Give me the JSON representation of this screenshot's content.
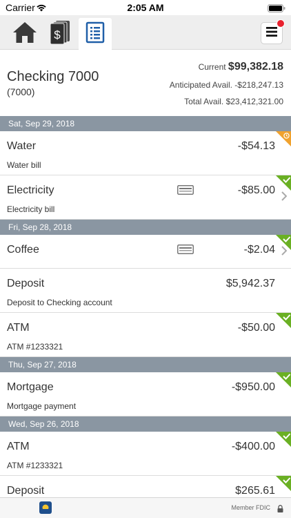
{
  "status_bar": {
    "carrier": "Carrier",
    "time": "2:05 AM"
  },
  "nav": {
    "tabs": [
      {
        "icon": "home-icon"
      },
      {
        "icon": "money-icon"
      },
      {
        "icon": "register-icon",
        "active": true
      }
    ],
    "menu_icon": "hamburger-menu-icon",
    "notification": true
  },
  "account": {
    "name": "Checking 7000",
    "number": "(7000)",
    "current_label": "Current",
    "current_value": "$99,382.18",
    "anticipated": "Anticipated Avail. -$218,247.13",
    "total": "Total Avail. $23,412,321.00"
  },
  "groups": [
    {
      "date": "Sat, Sep 29, 2018",
      "transactions": [
        {
          "desc": "Water",
          "amount": "-$54.13",
          "memo": "Water bill",
          "status": "pending"
        },
        {
          "desc": "Electricity",
          "amount": "-$85.00",
          "memo": "Electricity bill",
          "status": "cleared",
          "card": true,
          "chevron": true
        }
      ]
    },
    {
      "date": "Fri, Sep 28, 2018",
      "transactions": [
        {
          "desc": "Coffee",
          "amount": "-$2.04",
          "memo": "",
          "status": "cleared",
          "card": true,
          "chevron": true
        },
        {
          "desc": "Deposit",
          "amount": "$5,942.37",
          "memo": "Deposit to Checking account",
          "status": ""
        },
        {
          "desc": "ATM",
          "amount": "-$50.00",
          "memo": "ATM #1233321",
          "status": "cleared"
        }
      ]
    },
    {
      "date": "Thu, Sep 27, 2018",
      "transactions": [
        {
          "desc": "Mortgage",
          "amount": "-$950.00",
          "memo": "Mortgage payment",
          "status": "cleared"
        }
      ]
    },
    {
      "date": "Wed, Sep 26, 2018",
      "transactions": [
        {
          "desc": "ATM",
          "amount": "-$400.00",
          "memo": "ATM #1233321",
          "status": "cleared"
        },
        {
          "desc": "Deposit",
          "amount": "$265.61",
          "memo": "",
          "status": "cleared"
        }
      ]
    }
  ],
  "footer": {
    "fdic": "Member FDIC",
    "lock_icon": "lock-icon"
  },
  "colors": {
    "date_header": "#8a96a2",
    "cleared": "#6ab023",
    "pending": "#f0a22e",
    "notification": "#e8212e",
    "register_blue": "#1f5fa8"
  }
}
